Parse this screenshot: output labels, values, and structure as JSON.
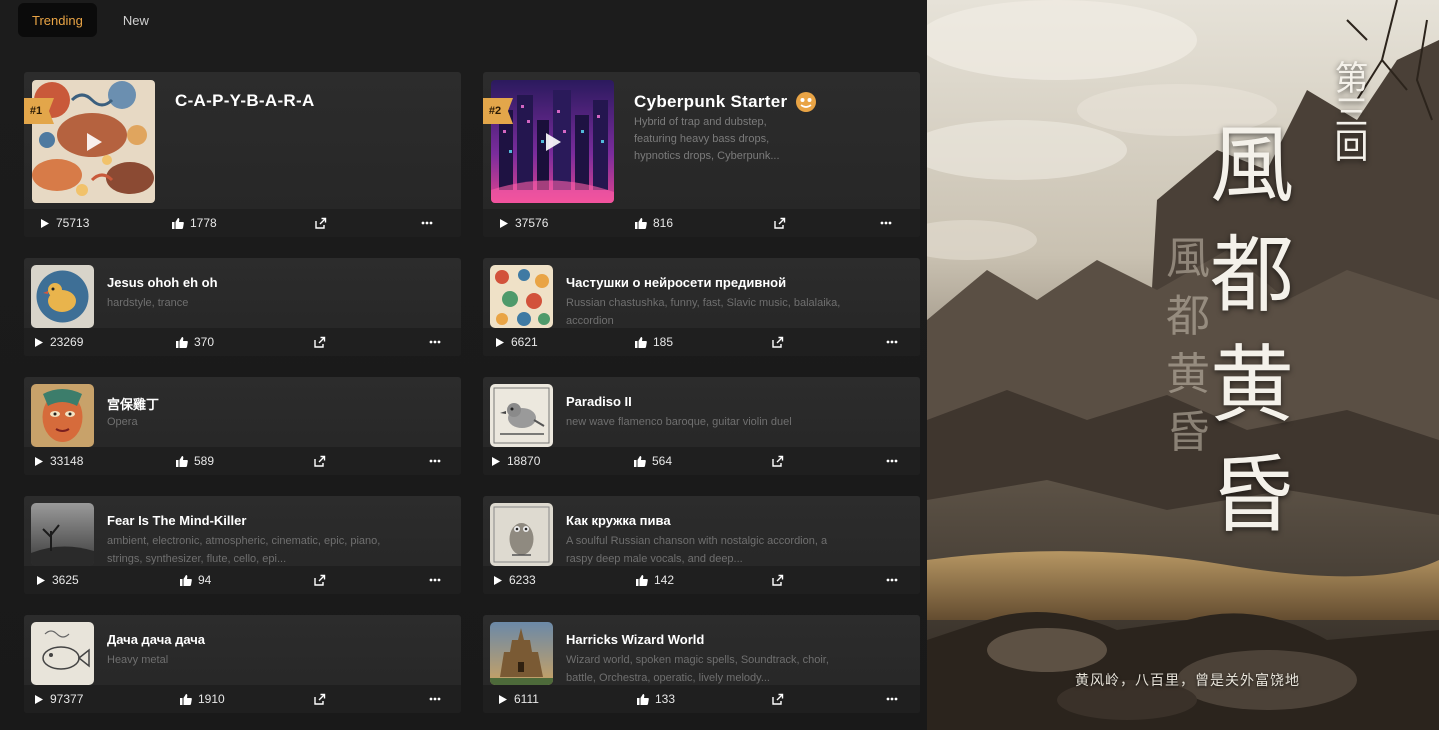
{
  "tabs": {
    "trending": "Trending",
    "new": "New"
  },
  "top_cards": [
    {
      "rank": "#1",
      "title": "C-A-P-Y-B-A-R-A",
      "desc": "",
      "plays": "75713",
      "likes": "1778"
    },
    {
      "rank": "#2",
      "title": "Cyberpunk Starter",
      "desc": "Hybrid of trap and dubstep, featuring heavy bass drops, hypnotics drops, Cyberpunk...",
      "plays": "37576",
      "likes": "816"
    }
  ],
  "left_cards": [
    {
      "title": "Jesus ohoh eh oh",
      "desc": "hardstyle, trance",
      "plays": "23269",
      "likes": "370"
    },
    {
      "title": "宫保雞丁",
      "desc": "Opera",
      "plays": "33148",
      "likes": "589"
    },
    {
      "title": "Fear Is The Mind-Killer",
      "desc": "ambient, electronic, atmospheric, cinematic, epic, piano, strings, synthesizer, flute, cello, epi...",
      "plays": "3625",
      "likes": "94"
    },
    {
      "title": "Дача дача дача",
      "desc": "Heavy metal",
      "plays": "97377",
      "likes": "1910"
    }
  ],
  "right_cards": [
    {
      "title": "Частушки о нейросети предивной",
      "desc": "Russian chastushka, funny, fast, Slavic music, balalaika, accordion",
      "plays": "6621",
      "likes": "185"
    },
    {
      "title": "Paradiso II",
      "desc": "new wave flamenco baroque, guitar violin duel",
      "plays": "18870",
      "likes": "564"
    },
    {
      "title": "Как кружка пива",
      "desc": "A soulful Russian chanson with nostalgic accordion, a raspy deep male vocals, and deep...",
      "plays": "6233",
      "likes": "142"
    },
    {
      "title": "Harricks Wizard World",
      "desc": "Wizard world, spoken magic spells, Soundtrack, choir, battle, Orchestra, operatic, lively melody...",
      "plays": "6111",
      "likes": "133"
    }
  ],
  "poster": {
    "chapter": "第三回",
    "title_chars": [
      "風",
      "都",
      "黄",
      "昏"
    ],
    "ghost_chars": [
      "風",
      "都",
      "黄",
      "昏"
    ],
    "caption": "黄风岭，八百里，曾是关外富饶地"
  },
  "colors": {
    "accent": "#e3a64a",
    "card_bg": "#2a2a2a",
    "footer_bg": "#1f1f1f"
  }
}
